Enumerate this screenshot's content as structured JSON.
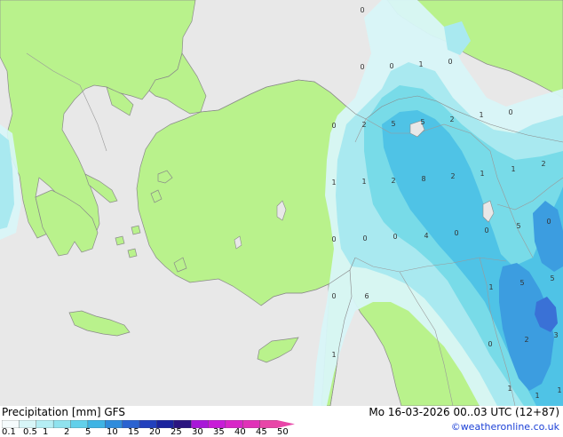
{
  "map": {
    "colors": {
      "sea": "#e8e8e8",
      "land": "#b9f28c",
      "coast": "#8a8a8a",
      "border": "#9a9a9a",
      "rain_light": "#d8f6f8",
      "rain_1": "#a9e9f0",
      "rain_2": "#78dbe8",
      "rain_5": "#4fc3e6",
      "rain_10": "#3c9de0",
      "rain_15": "#3a71d6"
    },
    "point_labels": [
      {
        "text": "0"
      },
      {
        "text": "0"
      },
      {
        "text": "0"
      },
      {
        "text": "1"
      },
      {
        "text": "0"
      },
      {
        "text": "0"
      },
      {
        "text": "2"
      },
      {
        "text": "5"
      },
      {
        "text": "5"
      },
      {
        "text": "2"
      },
      {
        "text": "1"
      },
      {
        "text": "0"
      },
      {
        "text": "1"
      },
      {
        "text": "1"
      },
      {
        "text": "2"
      },
      {
        "text": "8"
      },
      {
        "text": "2"
      },
      {
        "text": "1"
      },
      {
        "text": "1"
      },
      {
        "text": "2"
      },
      {
        "text": "0"
      },
      {
        "text": "0"
      },
      {
        "text": "0"
      },
      {
        "text": "4"
      },
      {
        "text": "0"
      },
      {
        "text": "0"
      },
      {
        "text": "5"
      },
      {
        "text": "0"
      },
      {
        "text": "0"
      },
      {
        "text": "6"
      },
      {
        "text": "1"
      },
      {
        "text": "5"
      },
      {
        "text": "5"
      },
      {
        "text": "0"
      },
      {
        "text": "2"
      },
      {
        "text": "3"
      },
      {
        "text": "1"
      },
      {
        "text": "1"
      },
      {
        "text": "1"
      },
      {
        "text": "1"
      }
    ]
  },
  "footer": {
    "title": "Precipitation [mm]  GFS",
    "datetime": "Mo 16-03-2026 00..03 UTC (12+87)",
    "credit": "©weatheronline.co.uk"
  },
  "legend": {
    "colors": [
      "#f5fbfc",
      "#d8f6f8",
      "#b5eef4",
      "#8fe2ee",
      "#62d0ea",
      "#3fb4e4",
      "#2f8cdc",
      "#2a63d0",
      "#2140bd",
      "#1a239e",
      "#2a1480",
      "#a818d8",
      "#c81cd8",
      "#d826c8",
      "#e032b8",
      "#e846a8"
    ],
    "ticks": [
      "0.1",
      "0.5",
      "1",
      "2",
      "5",
      "10",
      "15",
      "20",
      "25",
      "30",
      "35",
      "40",
      "45",
      "50"
    ]
  }
}
